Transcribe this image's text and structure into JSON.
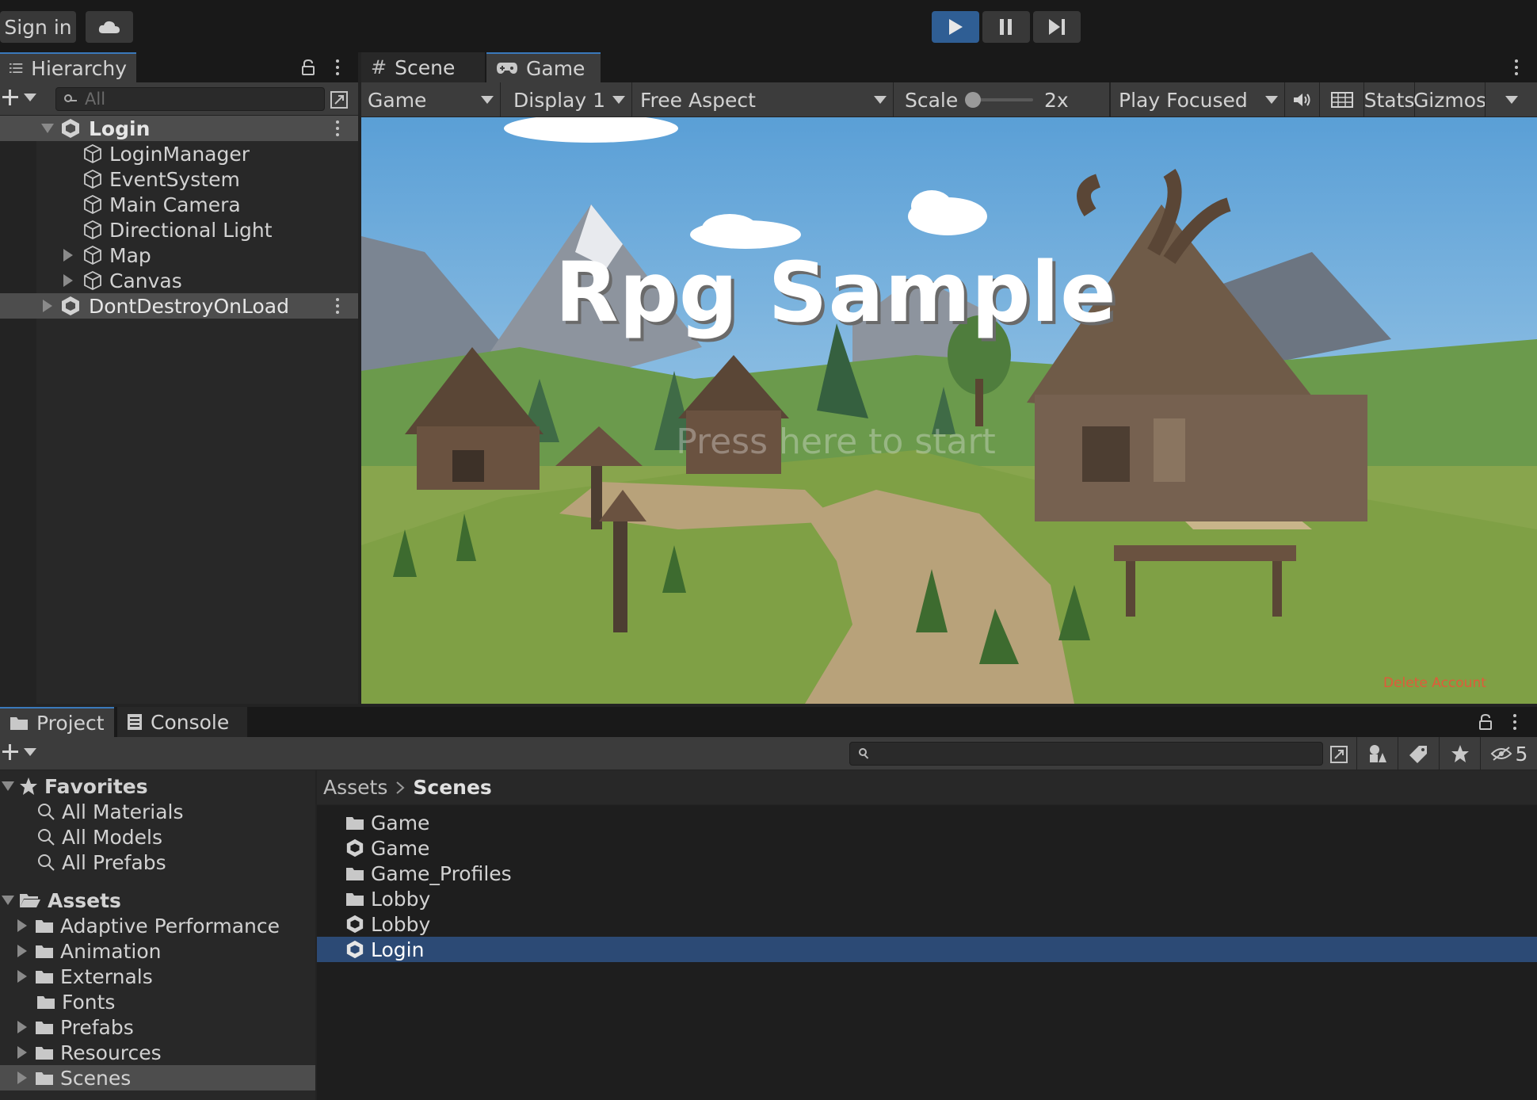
{
  "toolbar": {
    "sign_in": "Sign in",
    "cloud_icon": "cloud-icon",
    "play_icon": "play-icon",
    "pause_icon": "pause-icon",
    "step_icon": "step-icon",
    "accent": "#3a79bb"
  },
  "hierarchy": {
    "tab_label": "Hierarchy",
    "search_placeholder": "All",
    "scenes": [
      {
        "label": "Login",
        "children": [
          "LoginManager",
          "EventSystem",
          "Main Camera",
          "Directional Light",
          "Map",
          "Canvas"
        ]
      },
      {
        "label": "DontDestroyOnLoad"
      }
    ]
  },
  "viewport": {
    "tabs": [
      "Scene",
      "Game"
    ],
    "active_tab": "Game",
    "game_dropdown": "Game",
    "display_dropdown": "Display 1",
    "aspect_dropdown": "Free Aspect",
    "scale_label": "Scale",
    "scale_value": "2x",
    "scale_level": 0.0,
    "play_mode_dropdown": "Play Focused",
    "stats_label": "Stats",
    "gizmos_label": "Gizmos",
    "game_title": "Rpg Sample",
    "start_prompt": "Press here to start",
    "delete_account": "Delete Account"
  },
  "project": {
    "tabs": [
      "Project",
      "Console"
    ],
    "active_tab": "Project",
    "hidden_count": "5",
    "favorites_label": "Favorites",
    "favorites": [
      "All Materials",
      "All Models",
      "All Prefabs"
    ],
    "assets_label": "Assets",
    "folders": [
      "Adaptive Performance",
      "Animation",
      "Externals",
      "Fonts",
      "Prefabs",
      "Resources",
      "Scenes"
    ],
    "breadcrumb": [
      "Assets",
      "Scenes"
    ],
    "items": [
      {
        "type": "folder",
        "name": "Game"
      },
      {
        "type": "scene",
        "name": "Game"
      },
      {
        "type": "folder",
        "name": "Game_Profiles"
      },
      {
        "type": "folder",
        "name": "Lobby"
      },
      {
        "type": "scene",
        "name": "Lobby"
      },
      {
        "type": "scene",
        "name": "Login"
      }
    ],
    "selected_item": "Login"
  }
}
